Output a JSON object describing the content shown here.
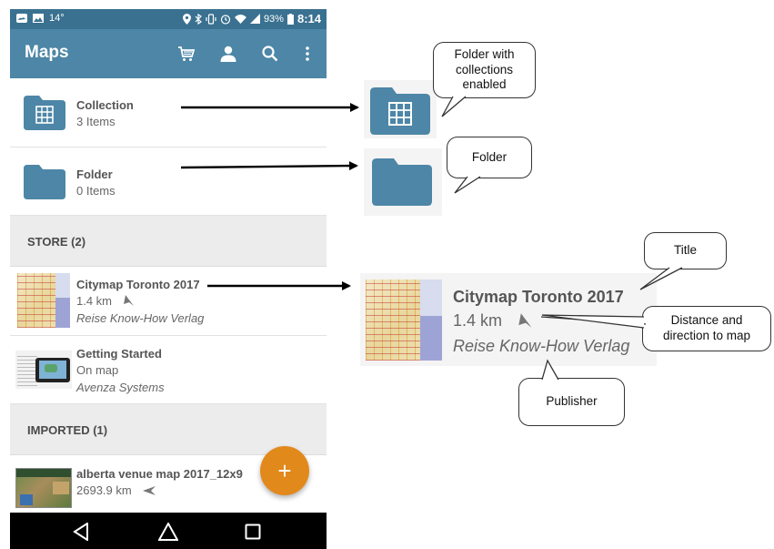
{
  "status_bar": {
    "temperature": "14°",
    "battery": "93%",
    "time": "8:14"
  },
  "app_bar": {
    "title": "Maps",
    "icons": [
      "cart-icon",
      "person-icon",
      "search-icon",
      "more-vert-icon"
    ]
  },
  "items": [
    {
      "name": "Collection",
      "sub": "3 Items",
      "icon": "collection-folder-icon"
    },
    {
      "name": "Folder",
      "sub": "0 Items",
      "icon": "folder-icon"
    }
  ],
  "store": {
    "header": "STORE (2)",
    "items": [
      {
        "name": "Citymap Toronto 2017",
        "distance": "1.4 km",
        "publisher": "Reise Know-How Verlag"
      },
      {
        "name": "Getting Started",
        "distance": "On map",
        "publisher": "Avenza Systems"
      }
    ]
  },
  "imported": {
    "header": "IMPORTED (1)",
    "items": [
      {
        "name": "alberta venue map 2017_12x9",
        "distance": "2693.9 km"
      }
    ]
  },
  "fab_label": "+",
  "nav_icons": [
    "back-icon",
    "home-icon",
    "recents-icon"
  ],
  "detail": {
    "title": "Citymap Toronto 2017",
    "distance": "1.4 km",
    "publisher": "Reise Know-How Verlag"
  },
  "callouts": {
    "collection": "Folder with collections enabled",
    "folder": "Folder",
    "title": "Title",
    "distance": "Distance and direction to map",
    "publisher": "Publisher"
  },
  "colors": {
    "app_bar": "#4d86a6",
    "status_bar": "#3a7190",
    "folder": "#4d86a6",
    "fab": "#e2891c"
  }
}
